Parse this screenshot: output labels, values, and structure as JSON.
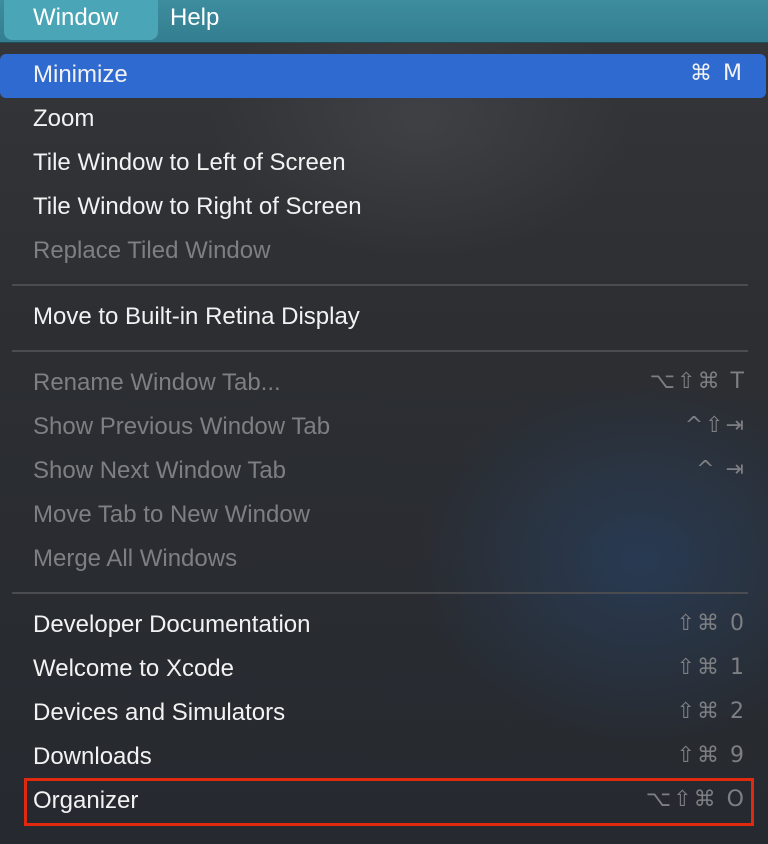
{
  "menubar": {
    "items": [
      {
        "label": "Window"
      },
      {
        "label": "Help"
      }
    ]
  },
  "menu": {
    "items": [
      {
        "label": "Minimize",
        "shortcut": "⌘ M",
        "enabled": true,
        "highlighted": true
      },
      {
        "label": "Zoom",
        "shortcut": "",
        "enabled": true
      },
      {
        "label": "Tile Window to Left of Screen",
        "shortcut": "",
        "enabled": true
      },
      {
        "label": "Tile Window to Right of Screen",
        "shortcut": "",
        "enabled": true
      },
      {
        "label": "Replace Tiled Window",
        "shortcut": "",
        "enabled": false
      },
      {
        "label": "Move to Built-in Retina Display",
        "shortcut": "",
        "enabled": true
      },
      {
        "label": "Rename Window Tab...",
        "shortcut": "⌥⇧⌘ T",
        "enabled": false
      },
      {
        "label": "Show Previous Window Tab",
        "shortcut": "^⇧⇥",
        "enabled": false
      },
      {
        "label": "Show Next Window Tab",
        "shortcut": "^ ⇥",
        "enabled": false
      },
      {
        "label": "Move Tab to New Window",
        "shortcut": "",
        "enabled": false
      },
      {
        "label": "Merge All Windows",
        "shortcut": "",
        "enabled": false
      },
      {
        "label": "Developer Documentation",
        "shortcut": "⇧⌘ 0",
        "enabled": true
      },
      {
        "label": "Welcome to Xcode",
        "shortcut": "⇧⌘ 1",
        "enabled": true
      },
      {
        "label": "Devices and Simulators",
        "shortcut": "⇧⌘ 2",
        "enabled": true
      },
      {
        "label": "Downloads",
        "shortcut": "⇧⌘ 9",
        "enabled": true
      },
      {
        "label": "Organizer",
        "shortcut": "⌥⇧⌘ O",
        "enabled": true,
        "annotated": true
      }
    ]
  },
  "colors": {
    "highlight": "#2f6ad0",
    "annotation_box": "#e0290e",
    "menubar": "#3d8d9e"
  }
}
